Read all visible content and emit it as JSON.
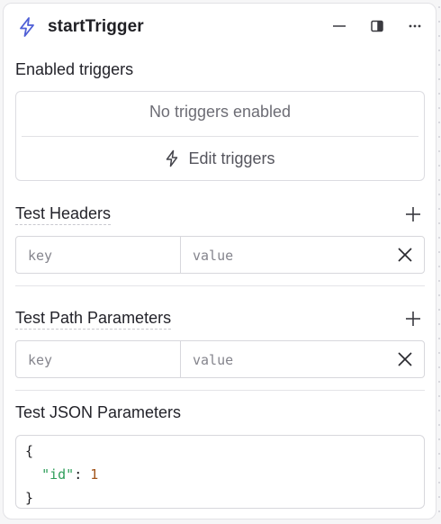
{
  "header": {
    "title": "startTrigger",
    "icons": [
      "lightning-bolt-icon",
      "minimize-icon",
      "side-panel-icon",
      "more-options-icon"
    ]
  },
  "triggers": {
    "section_title": "Enabled triggers",
    "empty_text": "No triggers enabled",
    "edit_label": "Edit triggers"
  },
  "test_headers": {
    "section_title": "Test Headers",
    "key_placeholder": "key",
    "value_placeholder": "value"
  },
  "test_path_parameters": {
    "section_title": "Test Path Parameters",
    "key_placeholder": "key",
    "value_placeholder": "value"
  },
  "test_json_parameters": {
    "section_title": "Test JSON Parameters",
    "lines": {
      "open_brace": "{",
      "key": "\"id\"",
      "colon": ": ",
      "value": "1",
      "close_brace": "}"
    }
  },
  "colors": {
    "accent_icon": "#4f5fd6",
    "json_key": "#2f9e5a",
    "json_number": "#a1541a"
  }
}
